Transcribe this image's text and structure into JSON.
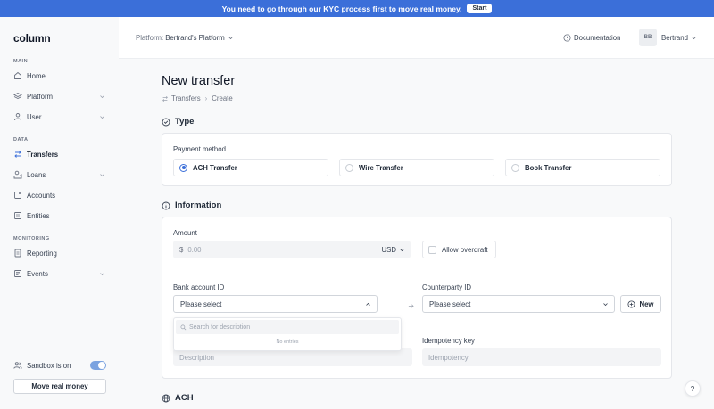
{
  "banner": {
    "text": "You need to go through our KYC process first to move real money.",
    "button": "Start"
  },
  "sidebar": {
    "logo": "column",
    "sections": {
      "main": "MAIN",
      "data": "DATA",
      "monitoring": "MONITORING"
    },
    "items": [
      {
        "label": "Home",
        "icon": "home-icon"
      },
      {
        "label": "Platform",
        "icon": "layers-icon"
      },
      {
        "label": "User",
        "icon": "user-icon"
      },
      {
        "label": "Transfers",
        "icon": "transfer-icon"
      },
      {
        "label": "Loans",
        "icon": "loans-icon"
      },
      {
        "label": "Accounts",
        "icon": "accounts-icon"
      },
      {
        "label": "Entities",
        "icon": "entities-icon"
      },
      {
        "label": "Reporting",
        "icon": "reporting-icon"
      },
      {
        "label": "Events",
        "icon": "events-icon"
      }
    ],
    "sandbox_label": "Sandbox is on",
    "move_money": "Move real money"
  },
  "header": {
    "platform_prefix": "Platform:",
    "platform_name": "Bertrand's Platform",
    "docs": "Documentation",
    "avatar": "BB",
    "user": "Bertrand"
  },
  "page": {
    "title": "New transfer",
    "breadcrumb": [
      "Transfers",
      "Create"
    ]
  },
  "type_section": {
    "title": "Type",
    "payment_method_label": "Payment method",
    "options": [
      "ACH Transfer",
      "Wire Transfer",
      "Book Transfer"
    ],
    "selected": "ACH Transfer"
  },
  "info_section": {
    "title": "Information",
    "amount_label": "Amount",
    "currency_symbol": "$",
    "amount_placeholder": "0.00",
    "currency": "USD",
    "allow_overdraft": "Allow overdraft",
    "bank_account_label": "Bank account ID",
    "bank_account_placeholder": "Please select",
    "counterparty_label": "Counterparty ID",
    "counterparty_placeholder": "Please select",
    "new_button": "New",
    "dropdown_search_placeholder": "Search for description",
    "dropdown_empty": "No entries",
    "idempotency_label": "Idempotency key",
    "description_placeholder": "Description",
    "idempotency_placeholder": "Idempotency"
  },
  "ach_section": {
    "title": "ACH"
  },
  "help": "?",
  "colors": {
    "accent": "#3b6fd9",
    "banner": "#3b6fd9",
    "toggle": "#7ba3e0"
  }
}
